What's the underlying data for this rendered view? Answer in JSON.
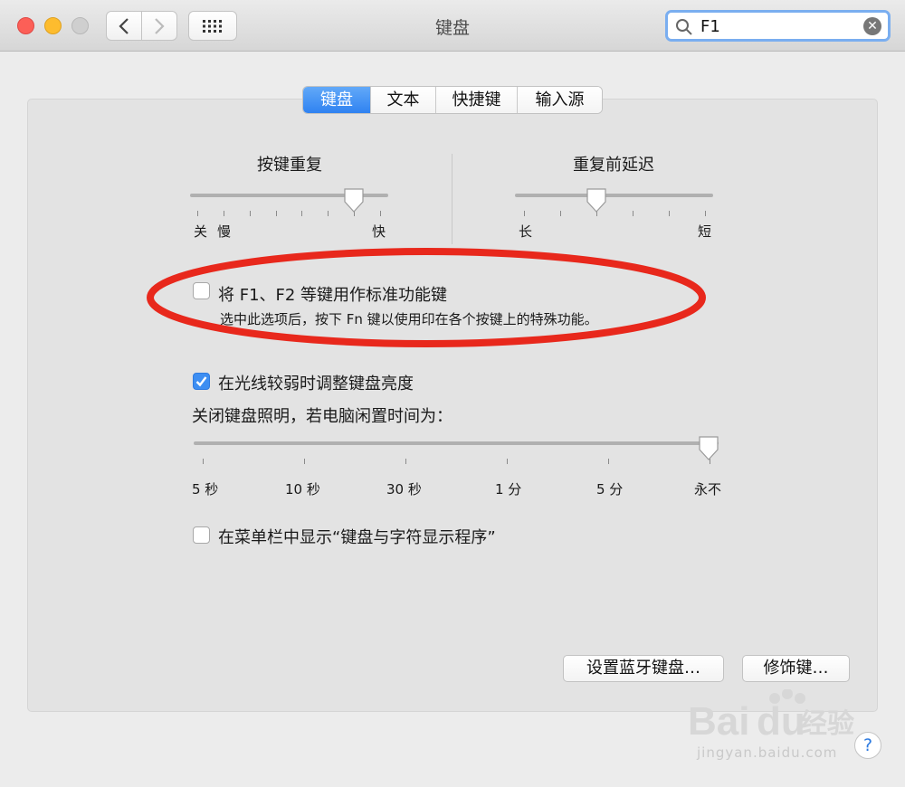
{
  "window": {
    "title": "键盘",
    "search": {
      "value": "F1",
      "placeholder": ""
    }
  },
  "tabs": [
    {
      "label": "键盘",
      "active": true
    },
    {
      "label": "文本",
      "active": false
    },
    {
      "label": "快捷键",
      "active": false
    },
    {
      "label": "输入源",
      "active": false
    }
  ],
  "key_repeat": {
    "heading": "按键重复",
    "labels": {
      "off": "关",
      "slow": "慢",
      "fast": "快"
    },
    "value_fraction": 0.82
  },
  "delay_until_repeat": {
    "heading": "重复前延迟",
    "labels": {
      "long": "长",
      "short": "短"
    },
    "value_fraction": 0.41
  },
  "fn_option": {
    "label": "将 F1、F2 等键用作标准功能键",
    "description": "选中此选项后，按下 Fn 键以使用印在各个按键上的特殊功能。",
    "checked": false
  },
  "backlight_option": {
    "label": "在光线较弱时调整键盘亮度",
    "checked": true
  },
  "turn_off_label": "关闭键盘照明，若电脑闲置时间为：",
  "turn_off_slider": {
    "ticks": [
      "5 秒",
      "10 秒",
      "30 秒",
      "1 分",
      "5 分",
      "永不"
    ],
    "selected": "永不"
  },
  "menu_bar_option": {
    "label": "在菜单栏中显示“键盘与字符显示程序”",
    "checked": false
  },
  "buttons": {
    "bluetooth": "设置蓝牙键盘…",
    "modifier": "修饰键…",
    "help": "?"
  },
  "watermark": {
    "brand": "Bai du 经验",
    "url": "jingyan.baidu.com"
  },
  "colors": {
    "accent": "#2f82f1",
    "annotation": "#e8281c"
  }
}
